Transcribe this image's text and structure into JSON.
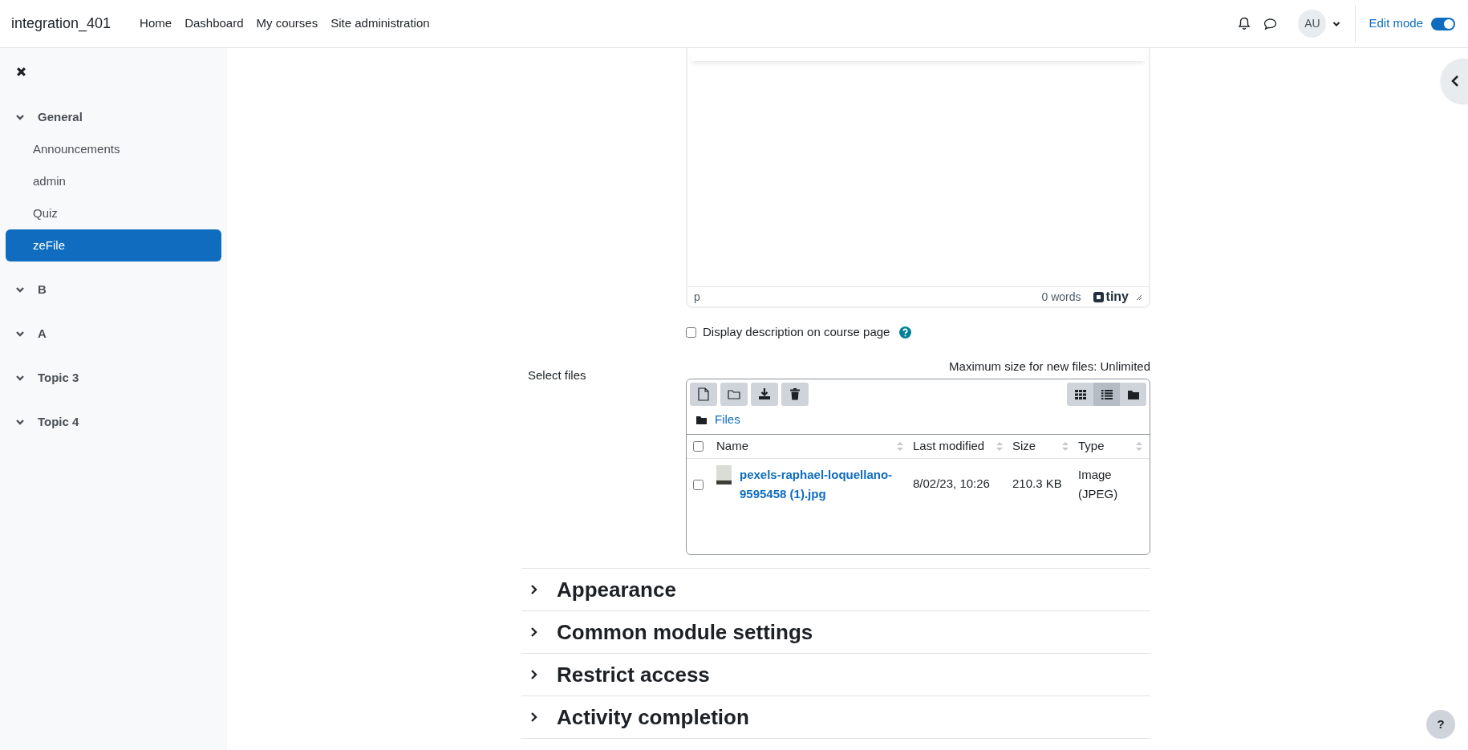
{
  "site_name": "integration_401",
  "nav": [
    {
      "label": "Home"
    },
    {
      "label": "Dashboard"
    },
    {
      "label": "My courses"
    },
    {
      "label": "Site administration"
    }
  ],
  "user_initials": "AU",
  "edit_mode": {
    "label": "Edit mode",
    "on": true
  },
  "course_index": [
    {
      "title": "General",
      "expanded": true,
      "items": [
        {
          "label": "Announcements",
          "selected": false
        },
        {
          "label": "admin",
          "selected": false
        },
        {
          "label": "Quiz",
          "selected": false
        },
        {
          "label": "zeFile",
          "selected": true
        }
      ]
    },
    {
      "title": "B",
      "expanded": true
    },
    {
      "title": "A",
      "expanded": true
    },
    {
      "title": "Topic 3",
      "expanded": true
    },
    {
      "title": "Topic 4",
      "expanded": true
    }
  ],
  "editor": {
    "element_path": "p",
    "word_count": "0 words",
    "brand": "tiny"
  },
  "display_description": {
    "label": "Display description on course page",
    "checked": false
  },
  "files": {
    "label": "Select files",
    "max_size": "Maximum size for new files: Unlimited",
    "view_modes": [
      {
        "kind": "icons",
        "selected": false
      },
      {
        "kind": "list",
        "selected": true
      },
      {
        "kind": "tree",
        "selected": false
      }
    ],
    "path": "Files",
    "select_all_checked": false,
    "columns": [
      "Name",
      "Last modified",
      "Size",
      "Type"
    ],
    "rows": [
      {
        "name": "pexels-raphael-loquellano-9595458 (1).jpg",
        "modified": "8/02/23, 10:26",
        "size": "210.3 KB",
        "type": "Image (JPEG)",
        "checked": false
      }
    ]
  },
  "sections": [
    {
      "title": "Appearance",
      "expanded": false
    },
    {
      "title": "Common module settings",
      "expanded": false
    },
    {
      "title": "Restrict access",
      "expanded": false
    },
    {
      "title": "Activity completion",
      "expanded": false
    }
  ],
  "help_button": "?"
}
